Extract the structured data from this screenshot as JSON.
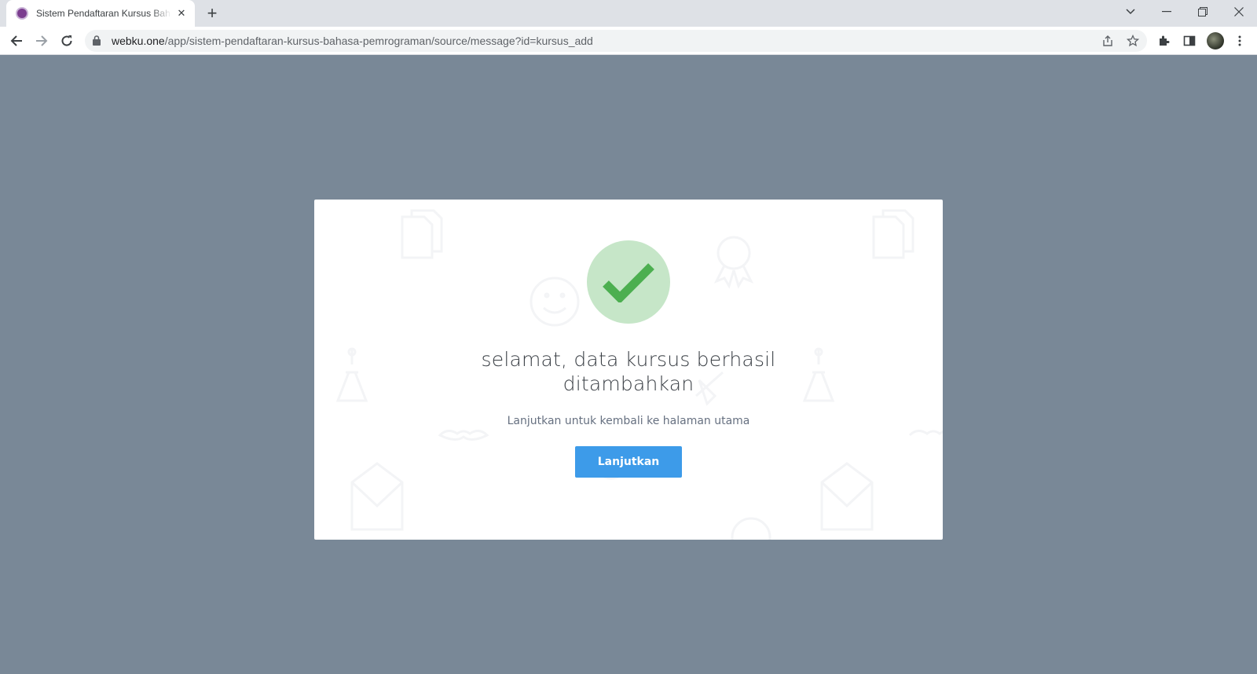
{
  "browser": {
    "tab_title": "Sistem Pendaftaran Kursus Bahasa Pemrograman",
    "url_domain": "webku.one",
    "url_path": "/app/sistem-pendaftaran-kursus-bahasa-pemrograman/source/message?id=kursus_add"
  },
  "message": {
    "headline": "selamat, data kursus berhasil ditambahkan",
    "subtext": "Lanjutkan untuk kembali ke halaman utama",
    "button_label": "Lanjutkan"
  },
  "colors": {
    "page_background": "#798897",
    "success_circle": "#c6e6c8",
    "success_check": "#4caf50",
    "button": "#3d9be9"
  }
}
